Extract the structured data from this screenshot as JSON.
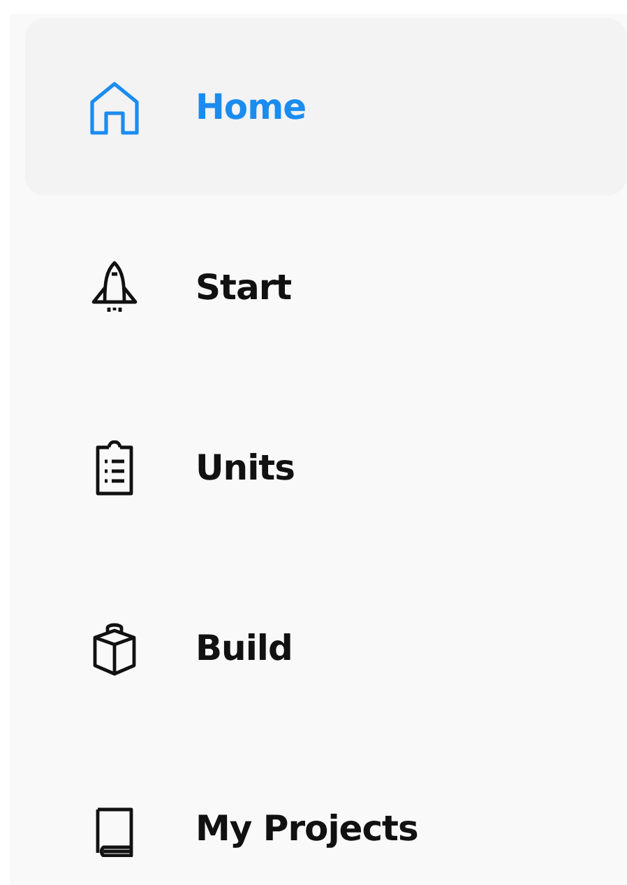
{
  "sidebar": {
    "items": [
      {
        "label": "Home",
        "selected": true
      },
      {
        "label": "Start",
        "selected": false
      },
      {
        "label": "Units",
        "selected": false
      },
      {
        "label": "Build",
        "selected": false
      },
      {
        "label": "My Projects",
        "selected": false
      }
    ]
  }
}
